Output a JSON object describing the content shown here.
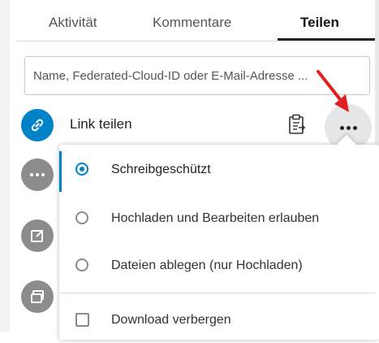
{
  "tabs": [
    {
      "label": "Aktivität",
      "active": false
    },
    {
      "label": "Kommentare",
      "active": false
    },
    {
      "label": "Teilen",
      "active": true
    }
  ],
  "search": {
    "placeholder": "Name, Federated-Cloud-ID oder E-Mail-Adresse ..."
  },
  "share_link": {
    "label": "Link teilen",
    "icon": "link-icon",
    "copy_icon": "clipboard-icon",
    "more_icon": "more-dots-icon"
  },
  "menu": {
    "options": [
      {
        "label": "Schreibgeschützt",
        "checked": true
      },
      {
        "label": "Hochladen und Bearbeiten erlauben",
        "checked": false
      },
      {
        "label": "Dateien ablegen (nur Hochladen)",
        "checked": false
      }
    ],
    "checkbox_label": "Download verbergen"
  },
  "colors": {
    "accent": "#0082c9",
    "annotation_arrow": "#e02020"
  }
}
